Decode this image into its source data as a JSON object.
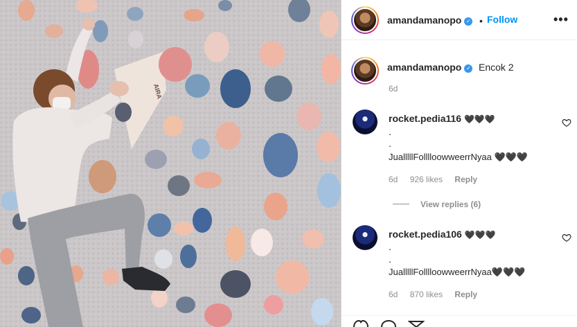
{
  "post": {
    "author": "amandamanopo",
    "follow_label": "Follow",
    "dot": "•",
    "more": "•••",
    "photo_text": "AIRA"
  },
  "caption": {
    "username": "amandamanopo",
    "text": "Encok 2",
    "time": "6d"
  },
  "comments": [
    {
      "username": "rocket.pedia116",
      "emoji": "🖤🖤🖤",
      "line1": ".",
      "line2": ".",
      "line3": "JualllllFolllloowweerrNyaa 🖤🖤🖤",
      "time": "6d",
      "likes": "926 likes",
      "reply": "Reply"
    },
    {
      "username": "rocket.pedia106",
      "emoji": "🖤🖤🖤",
      "line1": ".",
      "line2": ".",
      "line3": "JualllllFolllloowweerrNyaa🖤🖤🖤",
      "time": "6d",
      "likes": "870 likes",
      "reply": "Reply"
    }
  ],
  "view_replies": "View replies (6)",
  "colors": {
    "follow": "#0095f6",
    "verified": "#3897f0",
    "muted": "#8e8e8e"
  }
}
